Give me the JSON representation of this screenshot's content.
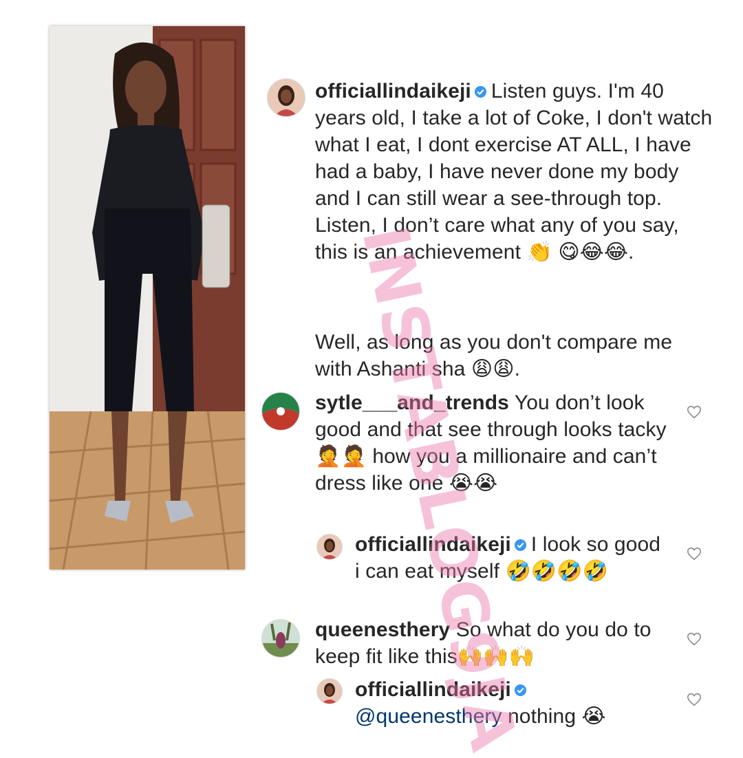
{
  "watermark": "INSTABLOG9JA",
  "post": {
    "username": "officiallindaikeji",
    "caption": "Listen guys. I'm 40 years old, I take a lot of Coke,  I don't watch what I eat, I dont exercise AT ALL, I have had a baby, I have never done my body and I can still wear a see-through top. Listen, I don’t care what any of you say, this is an achievement 👏 😋😂😂.",
    "caption_line2": "Well, as long as you don't compare me with Ashanti sha 😩😩."
  },
  "comments": [
    {
      "username": "sytle___and_trends",
      "text": "You don’t look good and that see through looks tacky 🤦🤦 how you a millionaire and can’t dress like one 😭😭"
    },
    {
      "username": "officiallindaikeji",
      "text": "I look so good i can eat myself 🤣🤣🤣🤣"
    },
    {
      "username": "queenesthery",
      "text": "So what do you do to keep fit like this🙌🙌🙌"
    },
    {
      "username": "officiallindaikeji",
      "mention": "@queenesthery",
      "text": "nothing 😭"
    }
  ],
  "colors": {
    "text": "#262626",
    "mention": "#00376b",
    "verified": "#3897f0",
    "watermark": "#ec78aa"
  }
}
